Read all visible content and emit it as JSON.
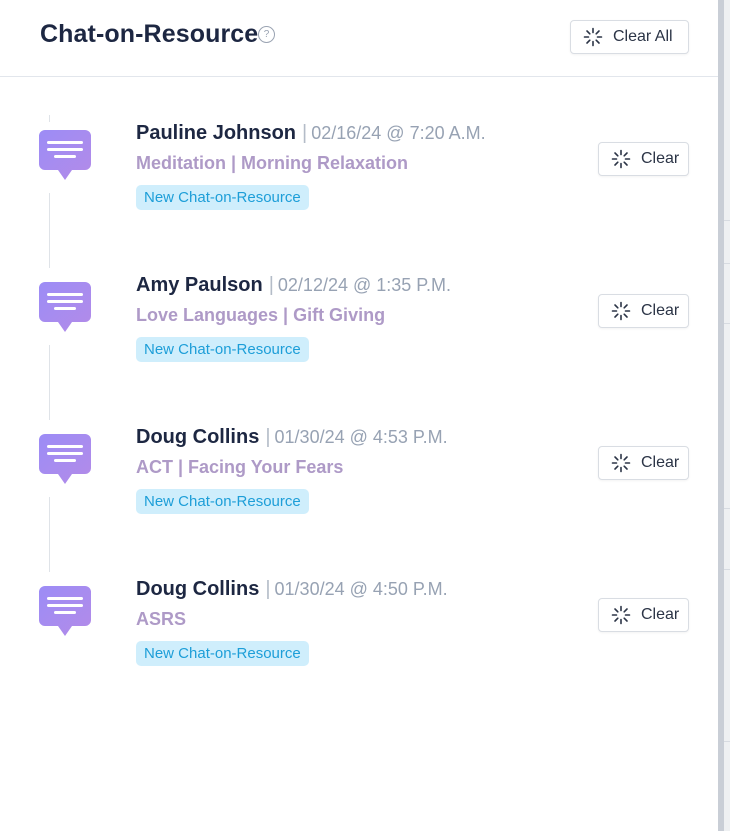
{
  "header": {
    "title": "Chat-on-Resource",
    "help_icon": "question-circle-icon",
    "clear_all_label": "Clear All"
  },
  "colors": {
    "badge_bg": "#cfeefc",
    "badge_text": "#1d9ed8",
    "resource_text": "#ae9ac7",
    "icon_gradient_start": "#9c8cf6",
    "icon_gradient_end": "#b38be8"
  },
  "items": [
    {
      "name": "Pauline Johnson",
      "timestamp": "02/16/24 @ 7:20 A.M.",
      "resource": "Meditation | Morning Relaxation",
      "badge": "New Chat-on-Resource",
      "clear_label": "Clear"
    },
    {
      "name": "Amy Paulson",
      "timestamp": "02/12/24 @ 1:35 P.M.",
      "resource": "Love Languages | Gift Giving",
      "badge": "New Chat-on-Resource",
      "clear_label": "Clear"
    },
    {
      "name": "Doug Collins",
      "timestamp": "01/30/24 @ 4:53 P.M.",
      "resource": "ACT | Facing Your Fears",
      "badge": "New Chat-on-Resource",
      "clear_label": "Clear"
    },
    {
      "name": "Doug Collins",
      "timestamp": "01/30/24 @ 4:50 P.M.",
      "resource": "ASRS",
      "badge": "New Chat-on-Resource",
      "clear_label": "Clear"
    }
  ]
}
